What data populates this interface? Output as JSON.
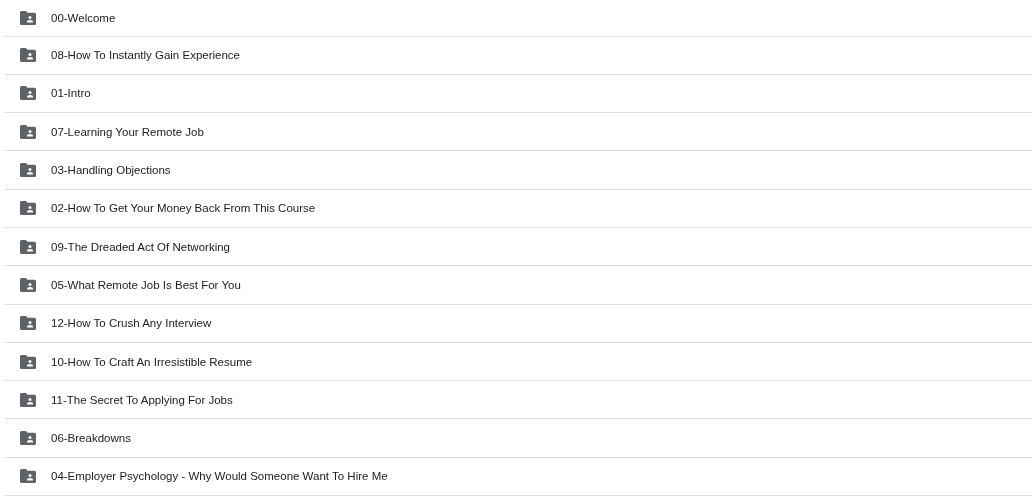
{
  "folders": [
    {
      "name": "00-Welcome"
    },
    {
      "name": "08-How To Instantly Gain Experience"
    },
    {
      "name": "01-Intro"
    },
    {
      "name": "07-Learning Your Remote Job"
    },
    {
      "name": "03-Handling Objections"
    },
    {
      "name": "02-How To Get Your Money Back From This Course"
    },
    {
      "name": "09-The Dreaded Act Of Networking"
    },
    {
      "name": "05-What Remote Job Is Best For You"
    },
    {
      "name": "12-How To Crush Any Interview"
    },
    {
      "name": "10-How To Craft An Irresistible Resume"
    },
    {
      "name": "11-The Secret To Applying For Jobs"
    },
    {
      "name": "06-Breakdowns"
    },
    {
      "name": "04-Employer Psychology - Why Would Someone Want To Hire Me"
    }
  ]
}
